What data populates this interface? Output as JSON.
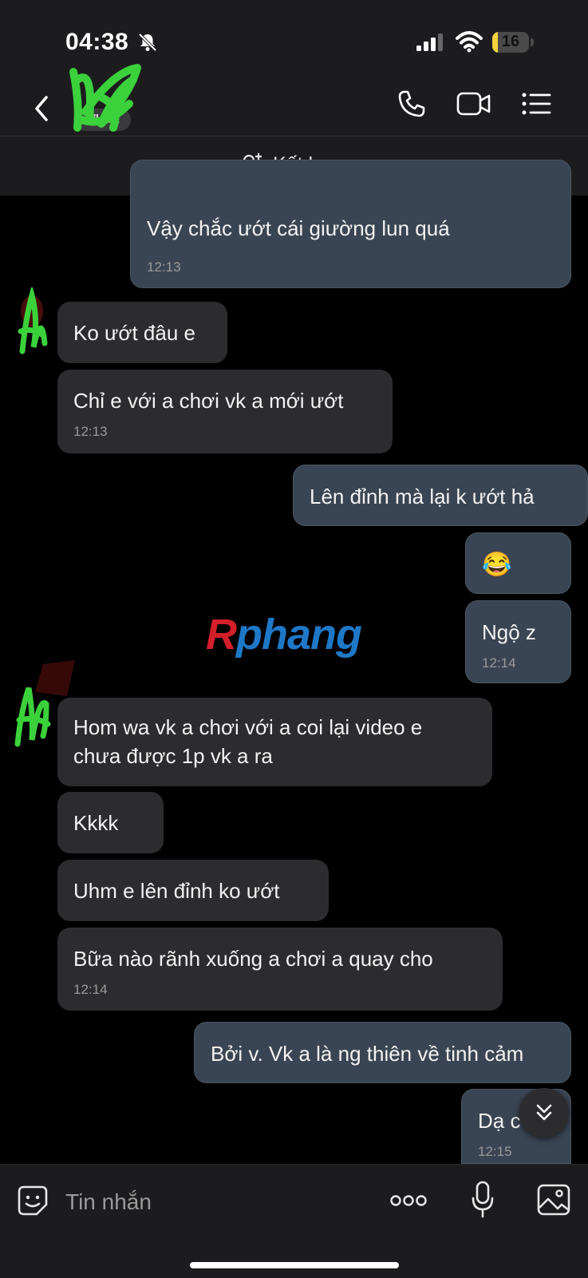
{
  "status_bar": {
    "time": "04:38",
    "battery": "16",
    "battery_level": 0.16
  },
  "header": {
    "badge": "NGƯỜI LẠ",
    "badge_visible": "ỚI LẠ"
  },
  "friend_bar": {
    "label": "Kết bạn"
  },
  "messages": [
    {
      "dir": "out",
      "text": "Vậy chắc ướt cái giường lun quá",
      "time": "12:13"
    },
    {
      "dir": "in",
      "text": "Ko ướt đâu  e"
    },
    {
      "dir": "in",
      "text": "Chỉ e với a chơi  vk a mới ướt",
      "time": "12:13"
    },
    {
      "dir": "out",
      "text": "Lên đỉnh mà lại k ướt hả"
    },
    {
      "dir": "out",
      "text": "😂"
    },
    {
      "dir": "out",
      "text": "Ngộ z",
      "time": "12:14"
    },
    {
      "dir": "in",
      "text_line1": "Hom wa vk a chơi  với  a coi lại video e",
      "text_line2": "chưa  được  1p vk a ra"
    },
    {
      "dir": "in",
      "text": "Kkkk"
    },
    {
      "dir": "in",
      "text": "Uhm e lên  đỉnh ko ướt"
    },
    {
      "dir": "in",
      "text": "Bữa  nào rãnh xuống  a chơi  a quay cho",
      "time": "12:14"
    },
    {
      "dir": "out",
      "text": "Bởi v. Vk a là ng thiên về tinh cảm"
    },
    {
      "dir": "out",
      "text": "Dạ c",
      "time": "12:15"
    }
  ],
  "watermark": {
    "first": "R",
    "rest": "phang"
  },
  "composer": {
    "placeholder": "Tin nhắn"
  },
  "icons": [
    "bell-slash-icon",
    "signal-icon",
    "wifi-icon",
    "battery-icon",
    "back-icon",
    "phone-icon",
    "video-icon",
    "menu-icon",
    "add-friend-icon",
    "scroll-down-icon",
    "sticker-icon",
    "more-icon",
    "mic-icon",
    "image-icon"
  ],
  "colors": {
    "bg": "#000000",
    "bar": "#1c1c1e",
    "bubble_in": "#2c2c2e",
    "bubble_out": "#3a4553",
    "battery": "#f5d13c",
    "scribble": "#3bd13b"
  }
}
